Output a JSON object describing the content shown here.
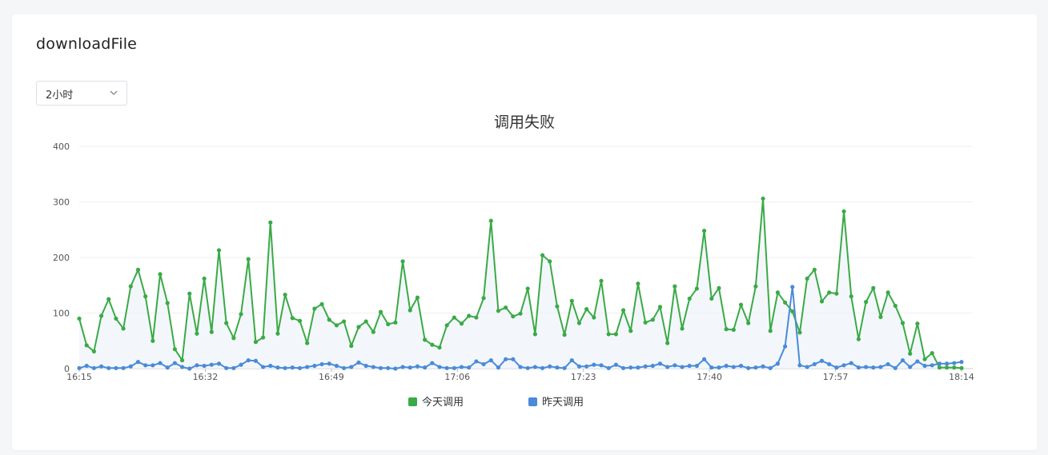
{
  "card": {
    "title": "downloadFile"
  },
  "range_select": {
    "value": "2小时",
    "icon": "chevron-down-icon"
  },
  "chart_data": {
    "type": "line",
    "title": "调用失败",
    "xlabel": "",
    "ylabel": "",
    "ylim": [
      0,
      400
    ],
    "y_ticks": [
      0,
      100,
      200,
      300,
      400
    ],
    "x_ticks": [
      "16:15",
      "16:32",
      "16:49",
      "17:06",
      "17:23",
      "17:40",
      "17:57",
      "18:14"
    ],
    "grid": true,
    "legend_position": "bottom-center",
    "series": [
      {
        "name": "今天调用",
        "color": "#3aaa45",
        "area": true,
        "values": [
          90,
          42,
          31,
          95,
          125,
          90,
          72,
          148,
          178,
          130,
          50,
          170,
          118,
          35,
          15,
          135,
          63,
          162,
          66,
          213,
          82,
          55,
          98,
          197,
          48,
          56,
          263,
          63,
          133,
          91,
          86,
          46,
          108,
          116,
          88,
          78,
          85,
          41,
          75,
          85,
          66,
          102,
          80,
          83,
          193,
          105,
          128,
          52,
          43,
          38,
          78,
          92,
          81,
          95,
          92,
          127,
          266,
          104,
          110,
          94,
          99,
          144,
          62,
          204,
          193,
          112,
          61,
          122,
          82,
          107,
          92,
          158,
          62,
          62,
          105,
          68,
          153,
          83,
          88,
          111,
          46,
          148,
          72,
          126,
          144,
          248,
          126,
          145,
          71,
          70,
          115,
          82,
          148,
          306,
          68,
          137,
          119,
          103,
          65,
          162,
          178,
          121,
          137,
          135,
          283,
          130,
          53,
          120,
          145,
          93,
          137,
          113,
          82,
          27,
          81,
          17,
          28,
          2,
          2,
          2,
          1
        ],
        "x_start": 0,
        "x_step": 1
      },
      {
        "name": "昨天调用",
        "color": "#4a8ad9",
        "area": false,
        "values": [
          1,
          5,
          1,
          4,
          1,
          1,
          1,
          4,
          12,
          6,
          6,
          10,
          2,
          10,
          3,
          0,
          6,
          5,
          7,
          9,
          1,
          1,
          7,
          15,
          14,
          3,
          5,
          2,
          1,
          2,
          1,
          3,
          5,
          8,
          9,
          5,
          1,
          3,
          11,
          5,
          3,
          1,
          1,
          0,
          3,
          2,
          4,
          2,
          10,
          3,
          1,
          1,
          3,
          2,
          13,
          8,
          15,
          2,
          17,
          17,
          3,
          1,
          3,
          1,
          4,
          2,
          1,
          15,
          4,
          4,
          7,
          6,
          1,
          7,
          1,
          2,
          2,
          4,
          5,
          9,
          3,
          6,
          3,
          5,
          5,
          17,
          2,
          2,
          5,
          3,
          5,
          1,
          2,
          4,
          1,
          9,
          40,
          147,
          6,
          3,
          8,
          14,
          8,
          2,
          6,
          10,
          2,
          3,
          2,
          3,
          8,
          1,
          15,
          3,
          13,
          5,
          6,
          9,
          9,
          10,
          12
        ],
        "x_start": 0,
        "x_step": 1
      }
    ]
  }
}
